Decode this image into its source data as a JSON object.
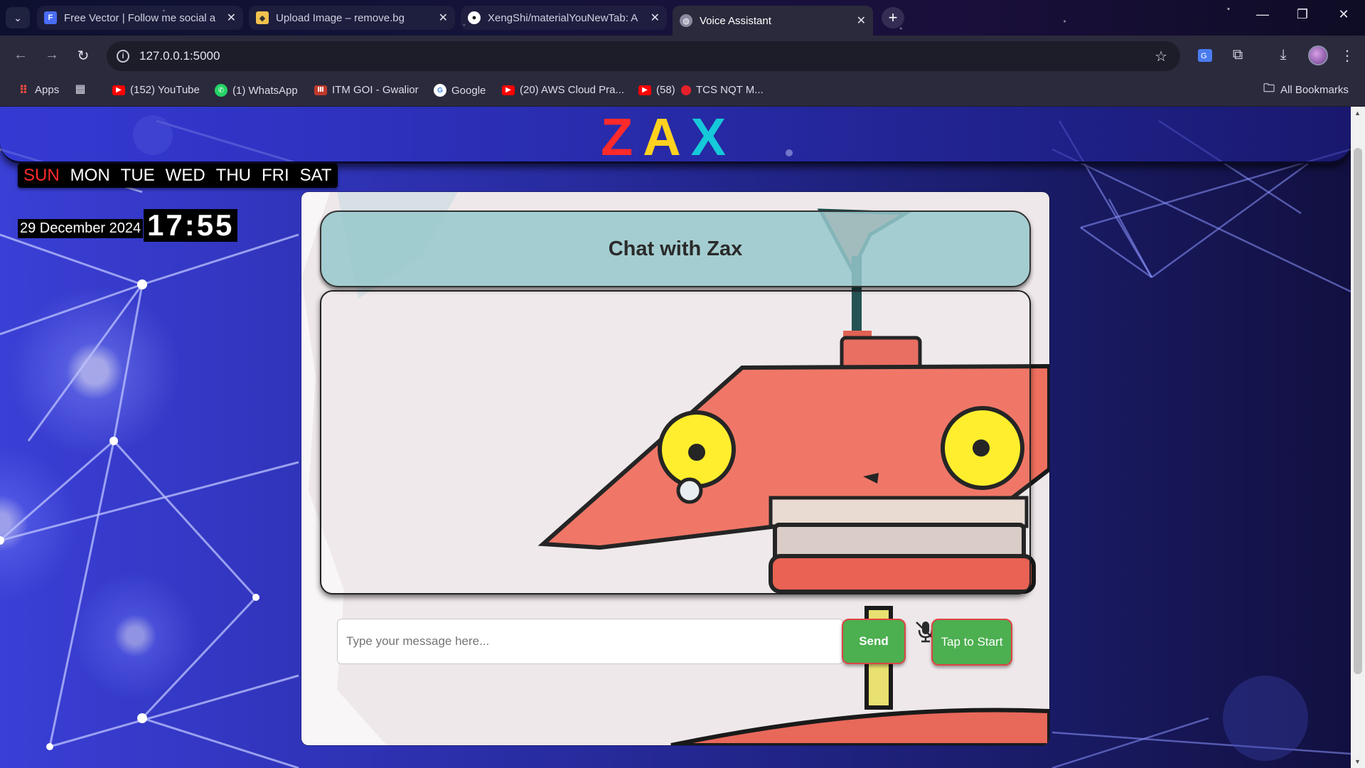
{
  "browser": {
    "tabs": [
      {
        "title": "Free Vector | Follow me social a",
        "favicon": "doc-icon",
        "color": "#4a6cf7"
      },
      {
        "title": "Upload Image – remove.bg",
        "favicon": "removebg-icon",
        "color": "#f2c14e"
      },
      {
        "title": "XengShi/materialYouNewTab: A",
        "favicon": "github-icon",
        "color": "#ffffff"
      },
      {
        "title": "Voice Assistant",
        "favicon": "globe-icon",
        "color": "#cfcfdf"
      }
    ],
    "url": "127.0.0.1:5000",
    "bookmarks": [
      {
        "label": "Apps",
        "icon": "apps-grid-icon"
      },
      {
        "label": "(152) YouTube",
        "icon": "youtube-icon"
      },
      {
        "label": "(1) WhatsApp",
        "icon": "whatsapp-icon"
      },
      {
        "label": "ITM GOI - Gwalior",
        "icon": "itm-icon"
      },
      {
        "label": "Google",
        "icon": "google-icon"
      },
      {
        "label": "(20) AWS Cloud Pra...",
        "icon": "youtube-icon"
      },
      {
        "label": "(58)",
        "icon": "youtube-icon"
      },
      {
        "label": "TCS NQT M...",
        "icon": "red-dot-icon"
      }
    ],
    "all_bookmarks": "All Bookmarks"
  },
  "page": {
    "logo": {
      "letters": [
        "Z",
        "A",
        "X"
      ],
      "colors": [
        "#ff2a2a",
        "#ffd21f",
        "#16c9d9"
      ]
    },
    "days": [
      "SUN",
      "MON",
      "TUE",
      "WED",
      "THU",
      "FRI",
      "SAT"
    ],
    "today": "SUN",
    "date": "29 December 2024",
    "time": "17:55",
    "chat": {
      "title": "Chat with Zax",
      "input_placeholder": "Type your message here...",
      "send_label": "Send",
      "start_label": "Tap to Start"
    },
    "colors": {
      "accent_green": "#4caf50",
      "header_teal": "#96c8cd"
    }
  }
}
